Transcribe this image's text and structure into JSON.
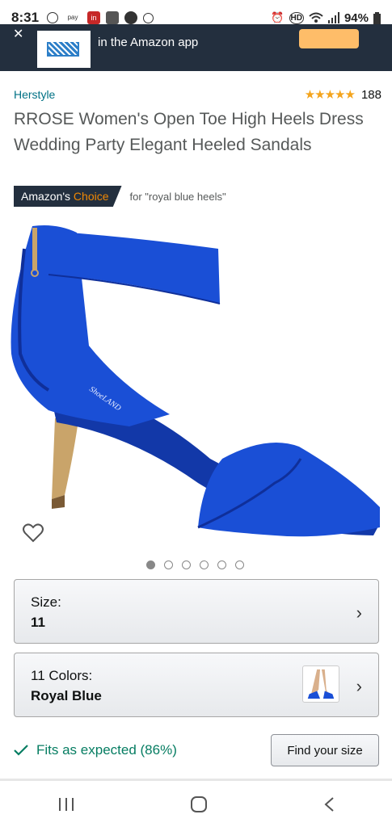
{
  "status_bar": {
    "time": "8:31",
    "battery": "94%",
    "icons": [
      "circle-icon",
      "pay-icon",
      "linkedin-icon",
      "slack-icon",
      "messenger-icon",
      "vpn-icon",
      "alarm-icon",
      "hd-icon",
      "wifi-icon",
      "signal-icon",
      "battery-icon"
    ]
  },
  "banner": {
    "text": "in the Amazon app"
  },
  "product": {
    "brand": "Herstyle",
    "rating_stars": "★★★★★",
    "review_count": "188",
    "title": "RROSE Women's Open Toe High Heels Dress Wedding Party Elegant Heeled Sandals",
    "choice_prefix": "Amazon's",
    "choice_word": "Choice",
    "choice_for": "for \"royal blue heels\"",
    "image_dots": 6,
    "active_dot": 0
  },
  "size_selector": {
    "label": "Size:",
    "value": "11"
  },
  "color_selector": {
    "label": "11 Colors:",
    "value": "Royal Blue"
  },
  "fit": {
    "text": "Fits as expected (86%)",
    "button_label": "Find your size"
  },
  "nav": {
    "recent_icon": "recent-apps-icon",
    "home_icon": "home-icon",
    "back_icon": "back-icon"
  },
  "colors": {
    "shoe": "#1a4fd6",
    "heel": "#c9a46a",
    "brand_link": "#007185",
    "fit_green": "#067d62",
    "star": "#f4a41c",
    "banner_bg": "#232f3e"
  }
}
